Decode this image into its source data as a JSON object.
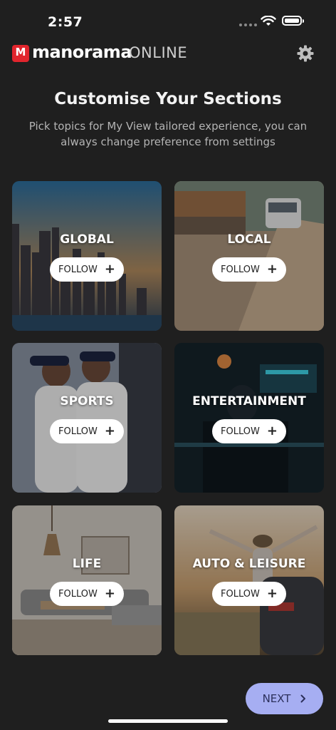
{
  "status": {
    "time": "2:57"
  },
  "header": {
    "brand": "manorama",
    "brand_suffix": "ONLINE",
    "icons": [
      "logo-icon",
      "gear-icon"
    ]
  },
  "intro": {
    "title": "Customise Your Sections",
    "subtitle": "Pick topics for My View tailored experience, you can always change preference from settings"
  },
  "sections": [
    {
      "label": "GLOBAL",
      "action": "FOLLOW",
      "icon": "plus-icon"
    },
    {
      "label": "LOCAL",
      "action": "FOLLOW",
      "icon": "plus-icon"
    },
    {
      "label": "SPORTS",
      "action": "FOLLOW",
      "icon": "plus-icon"
    },
    {
      "label": "ENTERTAINMENT",
      "action": "FOLLOW",
      "icon": "plus-icon"
    },
    {
      "label": "LIFE",
      "action": "FOLLOW",
      "icon": "plus-icon"
    },
    {
      "label": "AUTO & LEISURE",
      "action": "FOLLOW",
      "icon": "plus-icon"
    }
  ],
  "footer": {
    "next_label": "NEXT",
    "icon": "chevron-right-icon"
  },
  "colors": {
    "background": "#1f1f1f",
    "brand": "#e1252d",
    "next_button": "#a6aef2"
  }
}
